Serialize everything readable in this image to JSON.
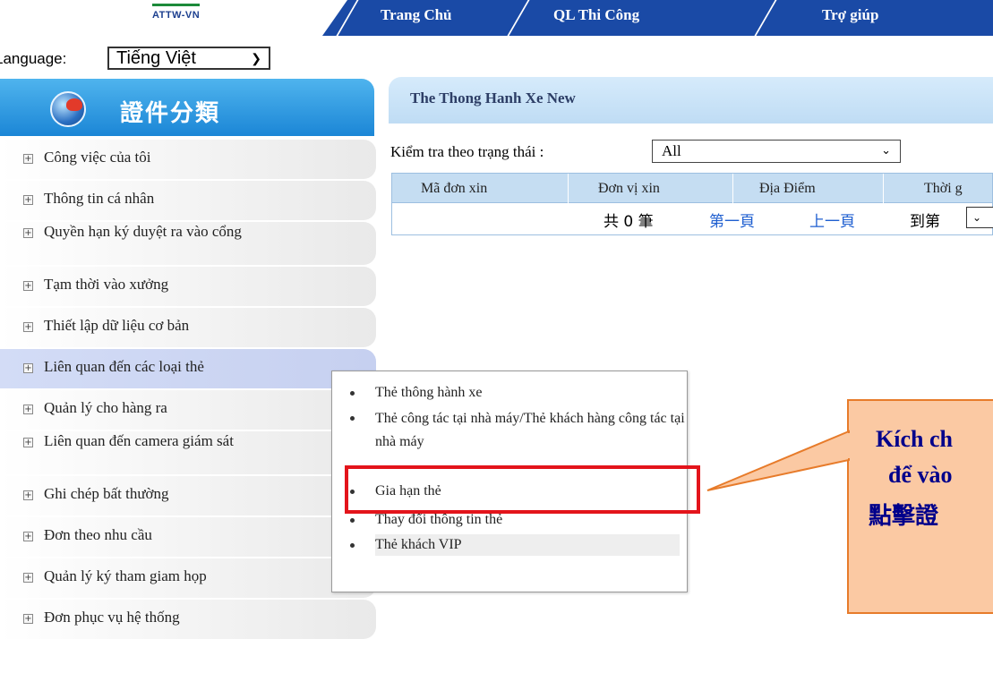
{
  "logo": {
    "text": "ATTW-VN"
  },
  "nav": {
    "items": [
      "Trang Chủ",
      "QL Thi Công",
      "Trợ giúp"
    ]
  },
  "language": {
    "label": "Language:",
    "selected": "Tiếng Việt",
    "chevron_icon": "chevron-down-icon"
  },
  "sidebar": {
    "title": "證件分類",
    "items": [
      "Công việc của tôi",
      "Thông tin cá nhân",
      "Quyền hạn ký duyệt ra vào cổng",
      "Tạm thời vào xưởng",
      "Thiết lập dữ liệu cơ bản",
      "Liên quan đến các loại thẻ",
      "Quản lý cho hàng ra",
      "Liên quan đến camera giám sát",
      "Ghi chép bất thường",
      "Đơn theo nhu cầu",
      "Quản lý ký tham giam họp",
      "Đơn phục vụ hệ thống"
    ]
  },
  "panel": {
    "title": "The Thong Hanh Xe New",
    "filter": {
      "label": "Kiểm tra theo trạng thái :",
      "selected": "All"
    },
    "columns": [
      "Mã đơn xin",
      "Đơn vị xin",
      "Địa Điểm",
      "Thời g"
    ],
    "pager": {
      "total": "共 0 筆",
      "first": "第一頁",
      "prev": "上一頁",
      "goto": "到第"
    }
  },
  "popup_menu": {
    "items": [
      "Thẻ thông hành xe",
      "Thẻ công tác tại nhà máy/Thẻ khách hàng công tác tại nhà máy",
      "Gia hạn thẻ",
      "Thay đổi thông tin thẻ",
      "Thẻ khách VIP"
    ],
    "highlighted": "Gia hạn thẻ"
  },
  "callout": {
    "lines": [
      "Kích ch",
      "để vào",
      "點擊證"
    ]
  },
  "colors": {
    "nav": "#1a4aa6",
    "sidebar_header": "#1b86d6",
    "highlight": "#e3141b",
    "callout_fill": "#fbc9a3",
    "callout_text": "#00008b"
  }
}
